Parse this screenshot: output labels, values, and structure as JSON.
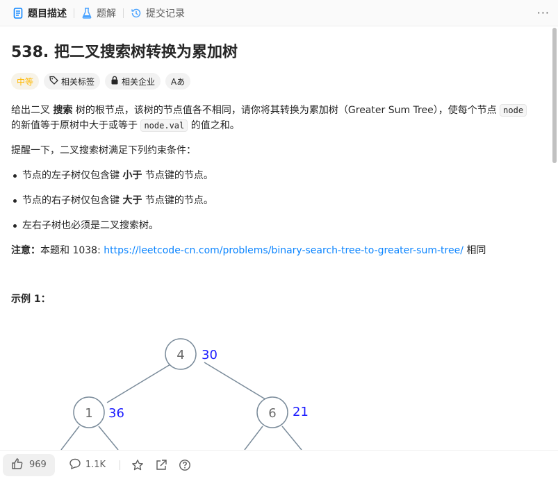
{
  "tabs": [
    {
      "label": "题目描述",
      "icon": "description-icon",
      "active": true
    },
    {
      "label": "题解",
      "icon": "flask-icon",
      "active": false
    },
    {
      "label": "提交记录",
      "icon": "history-icon",
      "active": false
    }
  ],
  "more_label": "···",
  "problem": {
    "title": "538. 把二叉搜索树转换为累加树",
    "difficulty": "中等",
    "tags": [
      "相关标签",
      "相关企业"
    ],
    "translate_label": "Aあ"
  },
  "description": {
    "p1": {
      "a": "给出二叉 ",
      "b": "搜索",
      "c": " 树的根节点，该树的节点值各不相同，请你将其转换为累加树（Greater Sum Tree），使每个节点 ",
      "code1": "node",
      "d": " 的新值等于原树中大于或等于 ",
      "code2": "node.val",
      "e": " 的值之和。"
    },
    "p2": "提醒一下，二叉搜索树满足下列约束条件：",
    "bullets": [
      {
        "a": "节点的左子树仅包含键 ",
        "b": "小于",
        "c": " 节点键的节点。"
      },
      {
        "a": "节点的右子树仅包含键 ",
        "b": "大于",
        "c": " 节点键的节点。"
      },
      {
        "a": "左右子树也必须是二叉搜索树。"
      }
    ],
    "note_label": "注意：",
    "note_text": "本题和 1038: ",
    "note_link": "https://leetcode-cn.com/problems/binary-search-tree-to-greater-sum-tree/",
    "note_suffix": " 相同",
    "example_title": "示例 1："
  },
  "tree": {
    "nodes": [
      {
        "value": "4",
        "sum": "30"
      },
      {
        "value": "1",
        "sum": "36"
      },
      {
        "value": "6",
        "sum": "21"
      }
    ]
  },
  "bottom": {
    "likes": "969",
    "comments": "1.1K"
  },
  "colors": {
    "accent": "#0a84ff",
    "difficulty": "#ffb800",
    "sum_label": "#1a1aff",
    "node_stroke": "#7a8b9a"
  }
}
